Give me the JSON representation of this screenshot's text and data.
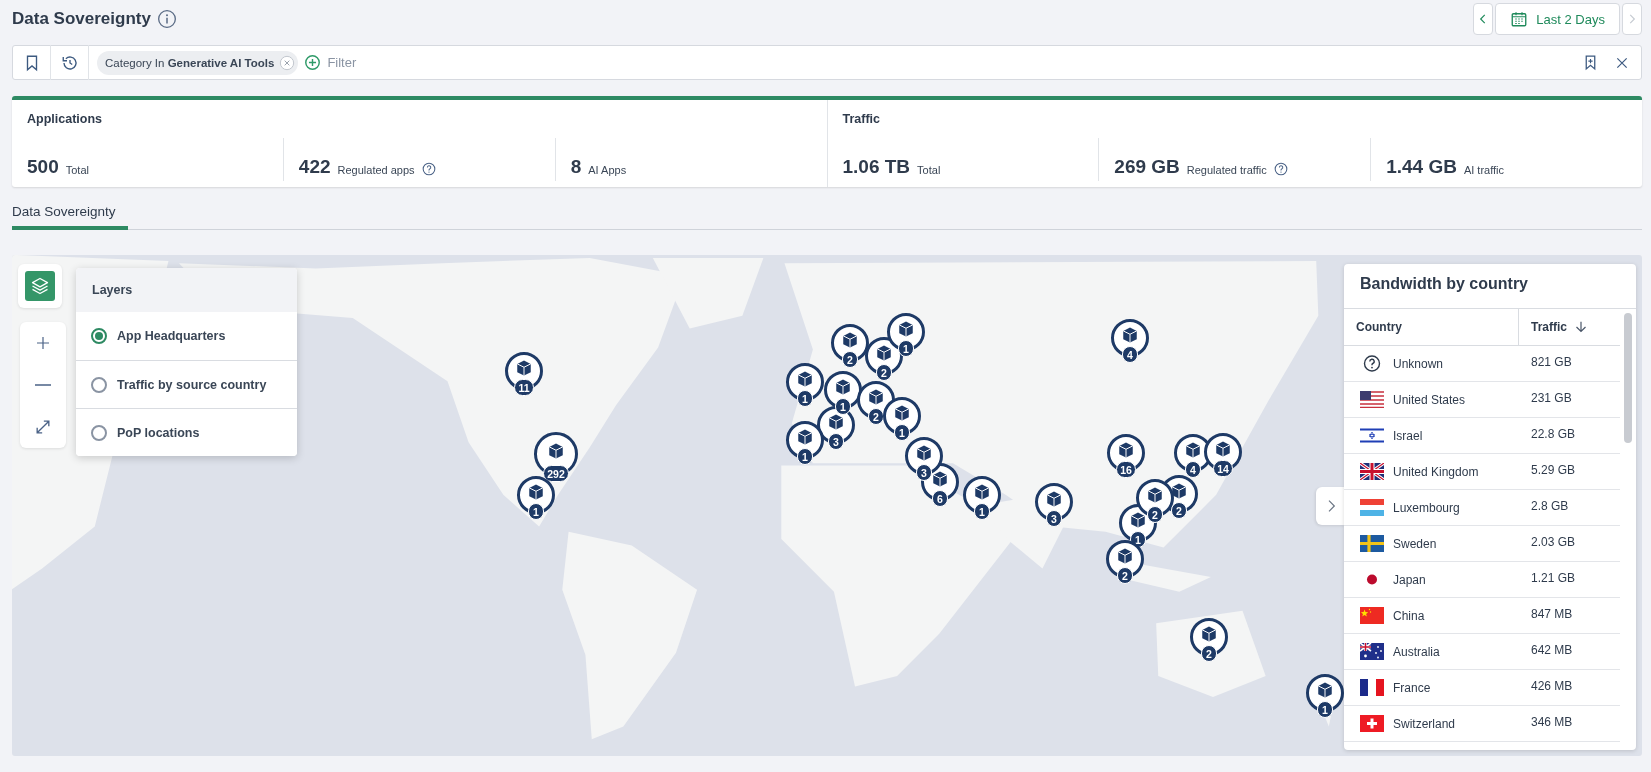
{
  "page": {
    "title": "Data Sovereignty"
  },
  "date_nav": {
    "prev_disabled": false,
    "label": "Last 2 Days",
    "next_disabled": true
  },
  "filter_bar": {
    "chips": [
      {
        "text": "Category In **Generative AI Tools**"
      }
    ],
    "add_filter_label": "Filter"
  },
  "stats": [
    {
      "title": "Applications",
      "metrics": [
        {
          "value": "500",
          "label": "Total",
          "help": false
        },
        {
          "value": "422",
          "label": "Regulated apps",
          "help": true
        },
        {
          "value": "8",
          "label": "AI Apps",
          "help": false
        }
      ]
    },
    {
      "title": "Traffic",
      "metrics": [
        {
          "value": "1.06 TB",
          "label": "Total",
          "help": false
        },
        {
          "value": "269 GB",
          "label": "Regulated traffic",
          "help": true
        },
        {
          "value": "1.44 GB",
          "label": "AI traffic",
          "help": false
        }
      ]
    }
  ],
  "tabs": [
    {
      "label": "Data Sovereignty",
      "selected": true
    }
  ],
  "map": {
    "layers_panel": {
      "title": "Layers",
      "options": [
        {
          "label": "App Headquarters",
          "selected": true
        },
        {
          "label": "Traffic by source country",
          "selected": false
        },
        {
          "label": "PoP locations",
          "selected": false
        }
      ]
    },
    "markers": [
      {
        "count": "11"
      },
      {
        "count": "292"
      },
      {
        "count": "1"
      },
      {
        "count": "2"
      },
      {
        "count": "2"
      },
      {
        "count": "1"
      },
      {
        "count": "1"
      },
      {
        "count": "3"
      },
      {
        "count": "1"
      },
      {
        "count": "2"
      },
      {
        "count": "1"
      },
      {
        "count": "1"
      },
      {
        "count": "6"
      },
      {
        "count": "3"
      },
      {
        "count": "1"
      },
      {
        "count": "4"
      },
      {
        "count": "16"
      },
      {
        "count": "4"
      },
      {
        "count": "14"
      },
      {
        "count": "3"
      },
      {
        "count": "1"
      },
      {
        "count": "2"
      },
      {
        "count": "2"
      },
      {
        "count": "2"
      },
      {
        "count": "2"
      },
      {
        "count": "1"
      }
    ],
    "bandwidth": {
      "title": "Bandwidth by country",
      "columns": [
        {
          "label": "Country",
          "sorted_descending": false
        },
        {
          "label": "Traffic",
          "sorted_descending": true
        }
      ],
      "rows": [
        {
          "kind": "unknown",
          "country": "Unknown",
          "traffic": "821 GB"
        },
        {
          "kind": "us",
          "country": "United States",
          "traffic": "231 GB"
        },
        {
          "kind": "il",
          "country": "Israel",
          "traffic": "22.8 GB"
        },
        {
          "kind": "gb",
          "country": "United Kingdom",
          "traffic": "5.29 GB"
        },
        {
          "kind": "lu",
          "country": "Luxembourg",
          "traffic": "2.8 GB"
        },
        {
          "kind": "se",
          "country": "Sweden",
          "traffic": "2.03 GB"
        },
        {
          "kind": "jp",
          "country": "Japan",
          "traffic": "1.21 GB"
        },
        {
          "kind": "cn",
          "country": "China",
          "traffic": "847 MB"
        },
        {
          "kind": "au",
          "country": "Australia",
          "traffic": "642 MB"
        },
        {
          "kind": "fr",
          "country": "France",
          "traffic": "426 MB"
        },
        {
          "kind": "ch",
          "country": "Switzerland",
          "traffic": "346 MB"
        }
      ]
    }
  }
}
